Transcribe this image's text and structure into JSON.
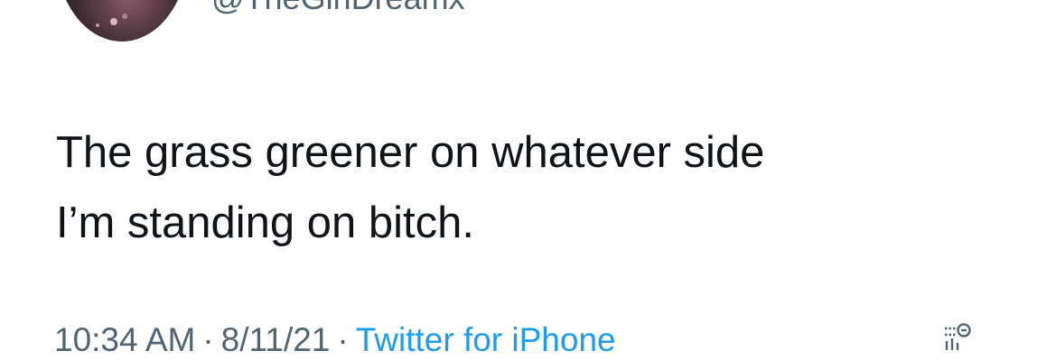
{
  "author": {
    "handle": "@TheGirlDreamx"
  },
  "tweet": {
    "line1": "The grass greener on whatever side",
    "line2": "I’m standing on bitch."
  },
  "meta": {
    "time": "10:34 AM",
    "separator": "·",
    "date": "8/11/21",
    "source": "Twitter for iPhone"
  },
  "icons": {
    "analytics": "analytics-icon"
  },
  "colors": {
    "text": "#0f1419",
    "secondary": "#536471",
    "link": "#1d9bf0"
  }
}
